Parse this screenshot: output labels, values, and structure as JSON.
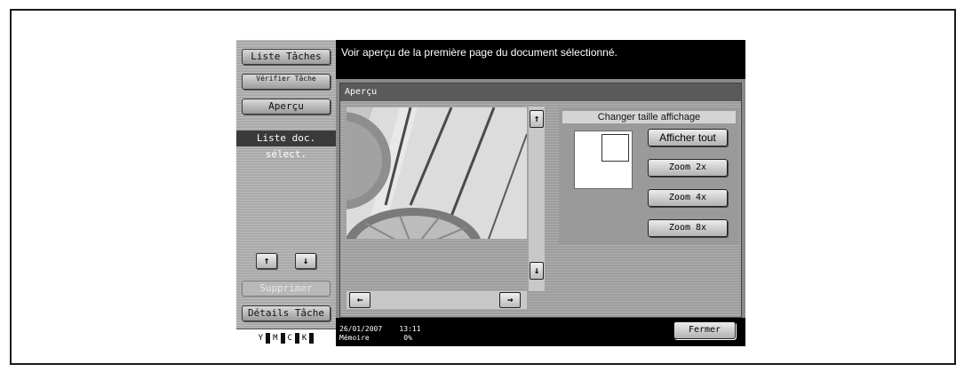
{
  "left": {
    "job_list": "Liste Tâches",
    "check_job": "Vérifier Tâche",
    "preview": "Aperçu",
    "doc_list_label": "Liste doc. sélect.",
    "up_arrow": "↑",
    "down_arrow": "↓",
    "delete": "Supprimer",
    "job_details": "Détails Tâche",
    "toner": [
      "Y",
      "M",
      "C",
      "K"
    ]
  },
  "header": {
    "message": "Voir aperçu de la première page du document sélectionné."
  },
  "panel": {
    "title": "Aperçu",
    "scroll_up": "↑",
    "scroll_down": "↓",
    "scroll_left": "←",
    "scroll_right": "→"
  },
  "size": {
    "title": "Changer taille affichage",
    "show_all": "Afficher tout",
    "zoom2": "Zoom 2x",
    "zoom4": "Zoom 4x",
    "zoom8": "Zoom 8x"
  },
  "status": {
    "datetime": "26/01/2007    13:11",
    "memory": "Mémoire        0%",
    "close": "Fermer"
  }
}
